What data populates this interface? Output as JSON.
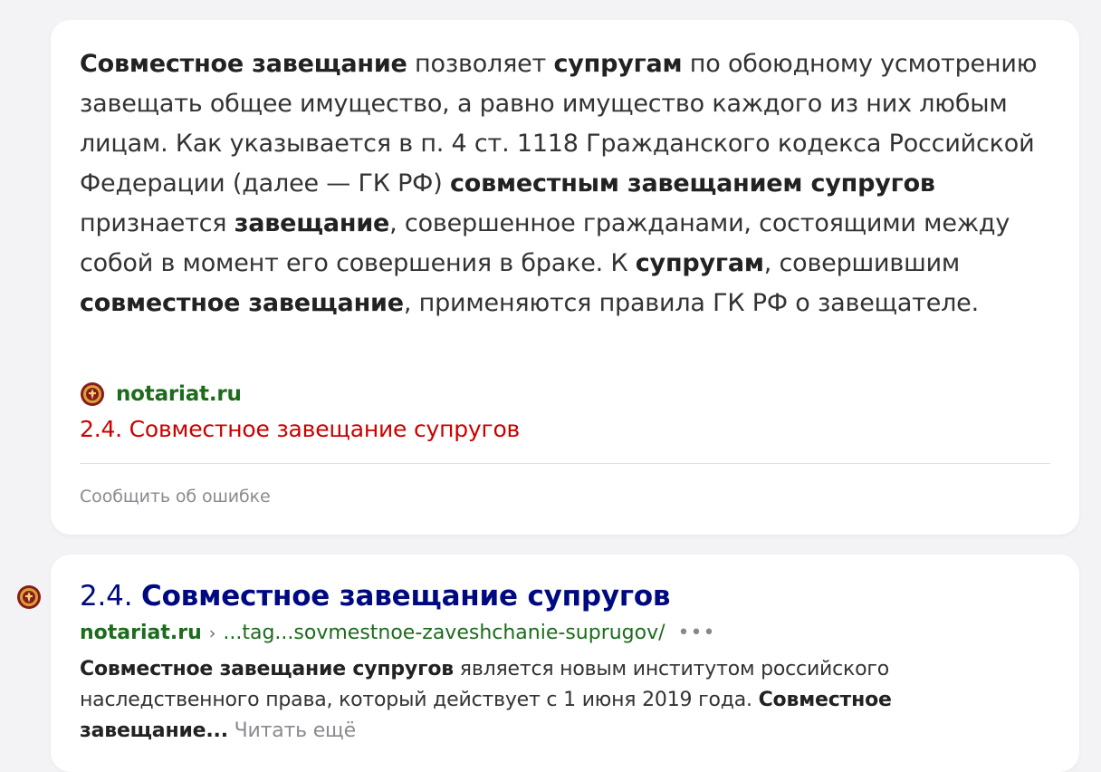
{
  "answer": {
    "segments": [
      {
        "text": "Совместное завещание",
        "bold": true
      },
      {
        "text": " позволяет ",
        "bold": false
      },
      {
        "text": "супругам",
        "bold": true
      },
      {
        "text": " по обоюдному усмотрению завещать общее имущество, а равно имущество каждого из них любым лицам. Как указывается в п. 4 ст. 1118 Гражданского кодекса Российской Федерации (далее — ГК РФ) ",
        "bold": false
      },
      {
        "text": "совместным завещанием супругов",
        "bold": true
      },
      {
        "text": " признается ",
        "bold": false
      },
      {
        "text": "завещание",
        "bold": true
      },
      {
        "text": ", совершенное гражданами, состоящими между собой в момент его совершения в браке. К ",
        "bold": false
      },
      {
        "text": "супругам",
        "bold": true
      },
      {
        "text": ", совершившим ",
        "bold": false
      },
      {
        "text": "совместное завещание",
        "bold": true
      },
      {
        "text": ", применяются правила ГК РФ о завещателе.",
        "bold": false
      }
    ],
    "source": {
      "favicon": "notary-emblem-icon",
      "domain": "notariat.ru",
      "title": "2.4. Совместное завещание супругов"
    },
    "report_label": "Сообщить об ошибке"
  },
  "result": {
    "favicon": "notary-emblem-icon",
    "title_number": "2.4.",
    "title_main": "Совместное завещание супругов",
    "url_domain": "notariat.ru",
    "url_separator": "›",
    "url_path": "...tag...sovmestnoe-zaveshchanie-suprugov/",
    "more_label": "•••",
    "snippet_segments": [
      {
        "text": "Совместное завещание супругов",
        "bold": true
      },
      {
        "text": " является новым институтом российского наследственного права, который действует с 1 июня 2019 года. ",
        "bold": false
      },
      {
        "text": "Совместное завещание...",
        "bold": true
      }
    ],
    "read_more": "Читать ещё"
  },
  "colors": {
    "link_green": "#1d6b1d",
    "source_title_red": "#cc0000",
    "result_title_blue": "#000a80",
    "muted_gray": "#8a8a90"
  }
}
